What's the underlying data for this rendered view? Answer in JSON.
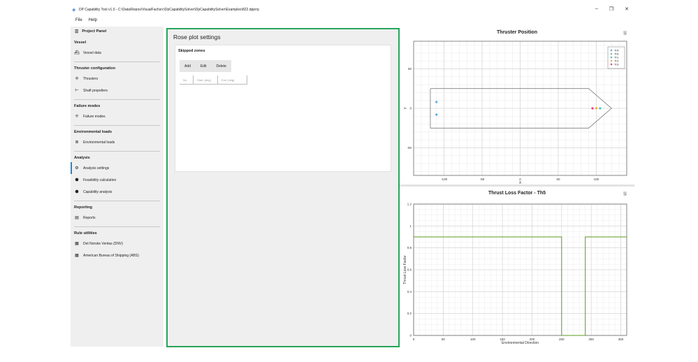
{
  "window": {
    "title": "DP Capability Tool v1.0 - C:\\Data\\Repos\\VisualFact\\src\\DpCapabilitySolver\\DpCapabilitySolver\\Examples\\822.dpproj",
    "minimize_glyph": "–",
    "restore_glyph": "❐",
    "close_glyph": "✕"
  },
  "menu": {
    "file": "File",
    "help": "Help"
  },
  "sidebar": {
    "header": "Project Panel",
    "sections": [
      {
        "title": "Vessel",
        "items": [
          {
            "label": "Vessel data",
            "icon": "ship-icon"
          }
        ]
      },
      {
        "title": "Thruster configuration",
        "items": [
          {
            "label": "Thrusters",
            "icon": "thrusters-icon"
          },
          {
            "label": "Shaft propellers",
            "icon": "propeller-icon"
          }
        ]
      },
      {
        "title": "Failure modes",
        "items": [
          {
            "label": "Failure modes",
            "icon": "failure-icon"
          }
        ]
      },
      {
        "title": "Environmental loads",
        "items": [
          {
            "label": "Environmental loads",
            "icon": "loads-icon"
          }
        ]
      },
      {
        "title": "Analysis",
        "items": [
          {
            "label": "Analysis settings",
            "icon": "settings-icon"
          },
          {
            "label": "Feasibility calculation",
            "icon": "calc-icon"
          },
          {
            "label": "Capability analysis",
            "icon": "capability-icon"
          }
        ]
      },
      {
        "title": "Reporting",
        "items": [
          {
            "label": "Reports",
            "icon": "report-icon"
          }
        ]
      },
      {
        "title": "Rule utilities",
        "items": [
          {
            "label": "Det Norske Veritas (DNV)",
            "icon": "rulebook-icon"
          },
          {
            "label": "American Bureau of Shipping (ABS)",
            "icon": "rulebook-icon"
          }
        ]
      }
    ],
    "active_item": "Analysis settings"
  },
  "rose": {
    "title": "Rose plot settings",
    "card_title": "Skipped zones",
    "add": "Add",
    "edit": "Edit",
    "delete": "Delete",
    "columns": [
      "No.",
      "Start, [deg]",
      "End, [deg]"
    ]
  },
  "thruster_position_chart": {
    "title": "Thruster Position",
    "xlabel": "X",
    "ylabel": "Y",
    "xticks": [
      -100,
      -50,
      0,
      50,
      100
    ],
    "yticks": [
      -50,
      0,
      50
    ],
    "legend": [
      {
        "name": "Th4",
        "color": "#5dade2"
      },
      {
        "name": "Th5",
        "color": "#58d68d"
      },
      {
        "name": "Th1",
        "color": "#48c9b0"
      },
      {
        "name": "Th2",
        "color": "#f5b041"
      },
      {
        "name": "Th3",
        "color": "#ec407a"
      }
    ]
  },
  "chart_data": [
    {
      "type": "scatter",
      "title": "Thruster Position",
      "xlabel": "X",
      "ylabel": "Y",
      "xlim": [
        -140,
        140
      ],
      "ylim": [
        -85,
        85
      ],
      "grid": true,
      "legend_position": "top-right",
      "series": [
        {
          "name": "Th4",
          "color": "#5dade2",
          "x": [
            -110
          ],
          "y": [
            8
          ]
        },
        {
          "name": "Th5",
          "color": "#5dade2",
          "x": [
            -110
          ],
          "y": [
            -8
          ]
        },
        {
          "name": "Th1",
          "color": "#48c9b0",
          "x": [
            105
          ],
          "y": [
            0
          ]
        },
        {
          "name": "Th2",
          "color": "#f5b041",
          "x": [
            100
          ],
          "y": [
            0
          ]
        },
        {
          "name": "Th3",
          "color": "#ec407a",
          "x": [
            95
          ],
          "y": [
            0
          ]
        }
      ],
      "hull_outline": {
        "x": [
          -118,
          90,
          120,
          90,
          -118,
          -118
        ],
        "y": [
          25,
          25,
          0,
          -25,
          -25,
          25
        ]
      }
    },
    {
      "type": "line",
      "title": "Thrust Loss Factor - Th5",
      "xlabel": "Environmental Direction",
      "ylabel": "Thrust Loss Factor",
      "xlim": [
        0,
        360
      ],
      "ylim": [
        0,
        1.2
      ],
      "xticks": [
        0,
        50,
        100,
        150,
        200,
        250,
        300,
        350
      ],
      "yticks": [
        0,
        0.2,
        0.4,
        0.6,
        0.8,
        1,
        1.2
      ],
      "grid": true,
      "color": "#5b9a1e",
      "x": [
        0,
        250,
        250,
        290,
        290,
        360
      ],
      "y": [
        0.9,
        0.9,
        0,
        0,
        0.9,
        0.9
      ]
    }
  ]
}
